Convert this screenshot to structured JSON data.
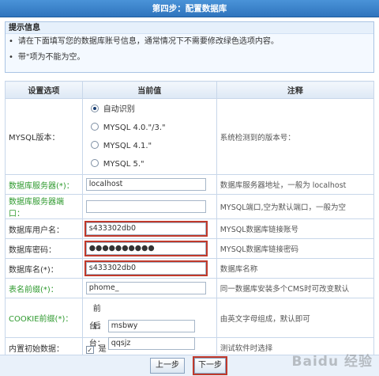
{
  "window": {
    "title": "第四步：配置数据库"
  },
  "notice": {
    "heading": "提示信息",
    "lines": [
      "请在下面填写您的数据库账号信息，通常情况下不需要修改绿色选项内容。",
      "带\"项为不能为空。"
    ]
  },
  "table": {
    "headers": [
      "设置选项",
      "当前值",
      "注释"
    ],
    "mysql_version": {
      "label": "MYSQL版本：",
      "options": [
        "自动识别",
        "MYSQL 4.0.\"/3.\"",
        "MYSQL 4.1.\"",
        "MYSQL 5.\""
      ],
      "selected_index": 0,
      "note": "系统检测到的版本号："
    },
    "rows": [
      {
        "label": "数据库服务器(*)：",
        "value": "localhost",
        "note": "数据库服务器地址，一般为 localhost"
      },
      {
        "label": "数据库服务器端口：",
        "value": "",
        "note": "MYSQL端口,空为默认端口，一般为空"
      },
      {
        "label": "数据库用户名：",
        "value": "s433302db0",
        "note": "MYSQL数据库链接账号"
      },
      {
        "label": "数据库密码：",
        "value": "●●●●●●●●●●",
        "note": "MYSQL数据库链接密码"
      },
      {
        "label": "数据库名(*)：",
        "value": "s433302db0",
        "note": "数据库名称"
      },
      {
        "label": "表名前缀(*)：",
        "value": "phome_",
        "note": "同一数据库安装多个CMS时可改变默认"
      }
    ],
    "cookie": {
      "label": "COOKIE前缀(*)：",
      "front_label": "前台：",
      "front_value": "msbwy",
      "back_label": "后台：",
      "back_value": "qqsjz",
      "note": "由英文字母组成，默认即可"
    },
    "builtin": {
      "label": "内置初始数据：",
      "checkbox_label": "是",
      "checked_mark": "✓",
      "note": "测试软件时选择"
    }
  },
  "buttons": {
    "prev": "上一步",
    "next": "下一步"
  },
  "watermark": "Baidu 经验"
}
